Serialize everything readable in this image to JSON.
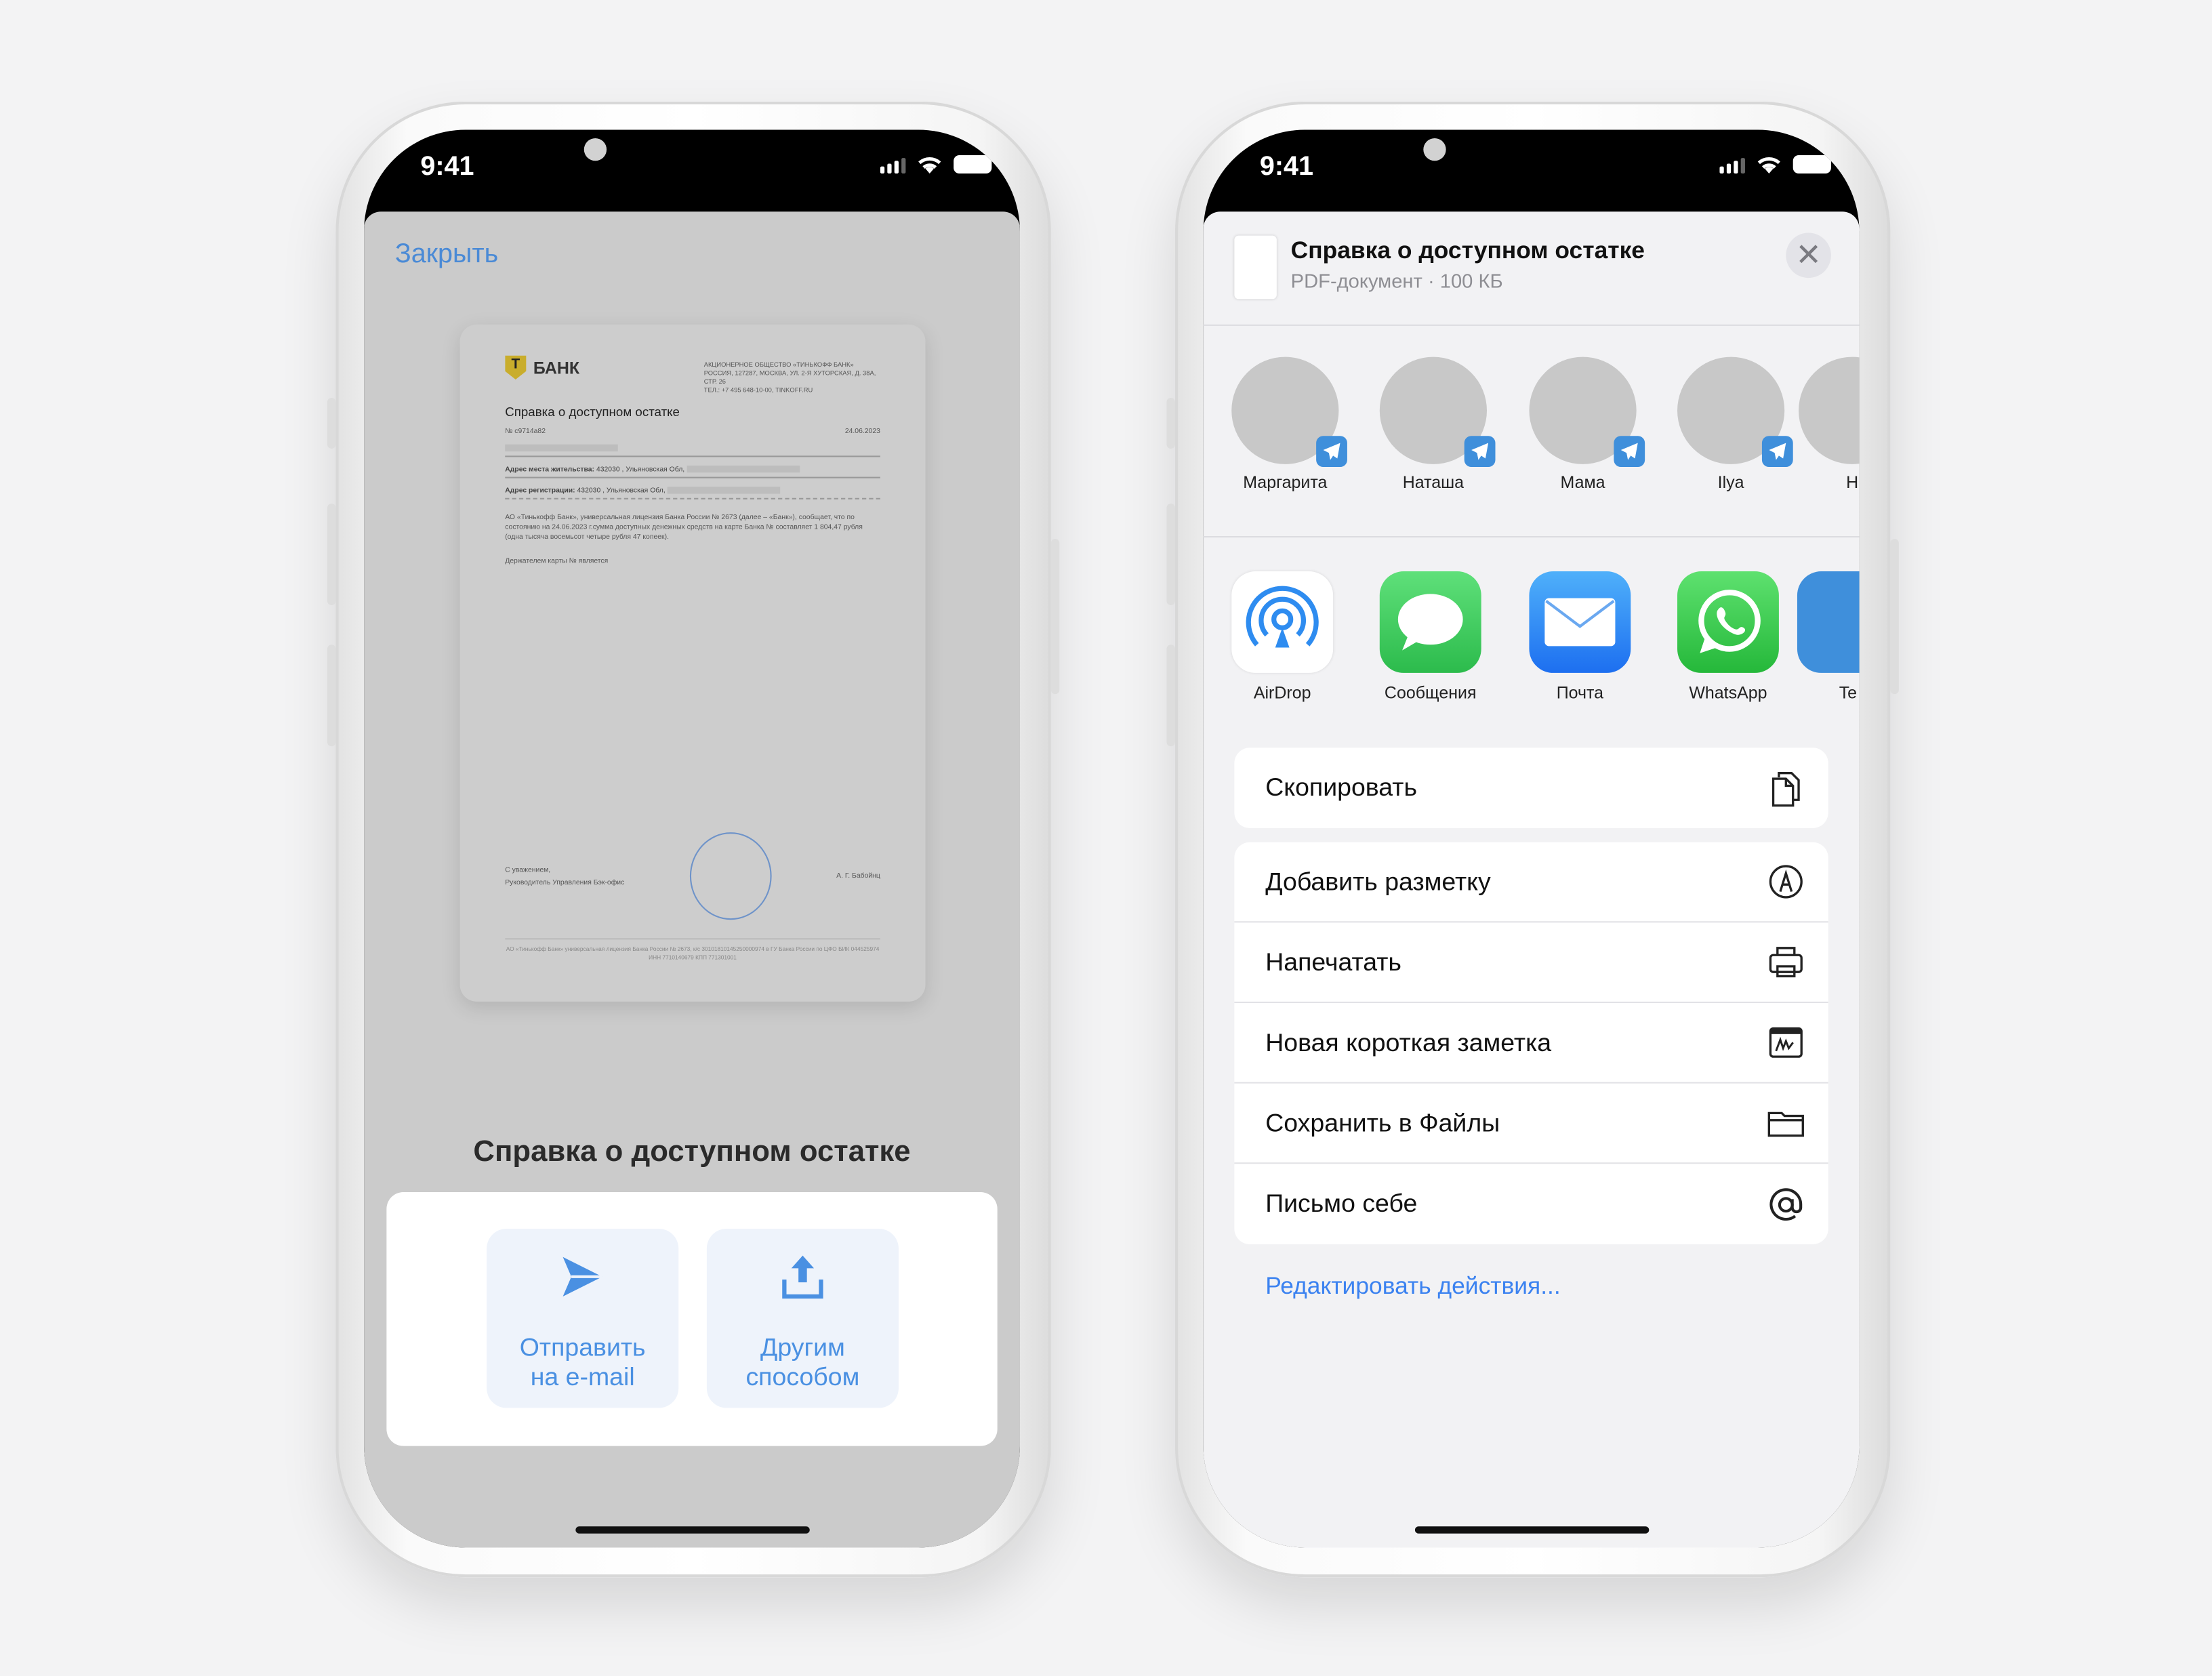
{
  "left_phone": {
    "status_time": "9:41",
    "close_label": "Закрыть",
    "document_preview": {
      "bank_logo": "Т БАНК",
      "address_lines": [
        "АКЦИОНЕРНОЕ ОБЩЕСТВО «ТИНЬКОФФ БАНК»",
        "РОССИЯ, 127287, МОСКВА, УЛ. 2-Я ХУТОРСКАЯ, Д. 38А, СТР. 26",
        "ТЕЛ.: +7 495 648-10-00, TINKOFF.RU"
      ],
      "title": "Справка о доступном остатке",
      "number": "№ c9714a82",
      "date": "24.06.2023",
      "residence_label": "Адрес места жительства:",
      "residence_value": "432030 , Ульяновская Обл,",
      "registration_label": "Адрес регистрации:",
      "registration_value": "432030 , Ульяновская Обл,",
      "body": "АО «Тинькофф Банк», универсальная лицензия Банка России № 2673 (далее – «Банк»), сообщает, что по состоянию на 24.06.2023 г.сумма доступных денежных средств на карте Банка № составляет 1 804,47 рубля (одна тысяча восемьсот четыре рубля 47 копеек).",
      "holder": "Держателем карты № является",
      "regards": "С уважением,",
      "position": "Руководитель Управления Бэк-офис",
      "signer": "А. Г. Бабойнц",
      "footer": "АО «Тинькофф Банк» универсальная лицензия Банка России № 2673, к/с 30101810145250000974 в ГУ Банка России по ЦФО БИК 044525974 ИНН 7710140679 КПП 771301001"
    },
    "document_title": "Справка о доступном остатке",
    "buttons": [
      {
        "label": "Отправить на e-mail",
        "line1": "Отправить",
        "line2": "на e-mail",
        "icon": "send-icon"
      },
      {
        "label": "Другим способом",
        "line1": "Другим",
        "line2": "способом",
        "icon": "share-upload-icon"
      }
    ]
  },
  "right_phone": {
    "status_time": "9:41",
    "share_header": {
      "title": "Справка о доступном остатке",
      "subtitle": "PDF-документ · 100 КБ"
    },
    "contacts": [
      {
        "name": "Маргарита",
        "badge": "telegram-icon"
      },
      {
        "name": "Наташа",
        "badge": "telegram-icon"
      },
      {
        "name": "Мама",
        "badge": "telegram-icon"
      },
      {
        "name": "Ilya",
        "badge": "telegram-icon"
      },
      {
        "name": "Н"
      }
    ],
    "apps": [
      {
        "name": "AirDrop",
        "color": "#ffffff"
      },
      {
        "name": "Сообщения",
        "color": "#34c759"
      },
      {
        "name": "Почта",
        "color": "#2e8cf0"
      },
      {
        "name": "WhatsApp",
        "color": "#2fc552"
      },
      {
        "name": "Te",
        "color": "#3f8fdb"
      }
    ],
    "actions_primary": [
      {
        "label": "Скопировать",
        "icon": "copy-icon"
      }
    ],
    "actions": [
      {
        "label": "Добавить разметку",
        "icon": "markup-icon"
      },
      {
        "label": "Напечатать",
        "icon": "printer-icon"
      },
      {
        "label": "Новая короткая заметка",
        "icon": "quick-note-icon"
      },
      {
        "label": "Сохранить в Файлы",
        "icon": "folder-icon"
      },
      {
        "label": "Письмо себе",
        "icon": "at-icon"
      }
    ],
    "edit_actions": "Редактировать действия..."
  },
  "colors": {
    "accent_blue": "#4a90e2",
    "ios_blue": "#3b82f0",
    "telegram": "#3f8fdb"
  }
}
